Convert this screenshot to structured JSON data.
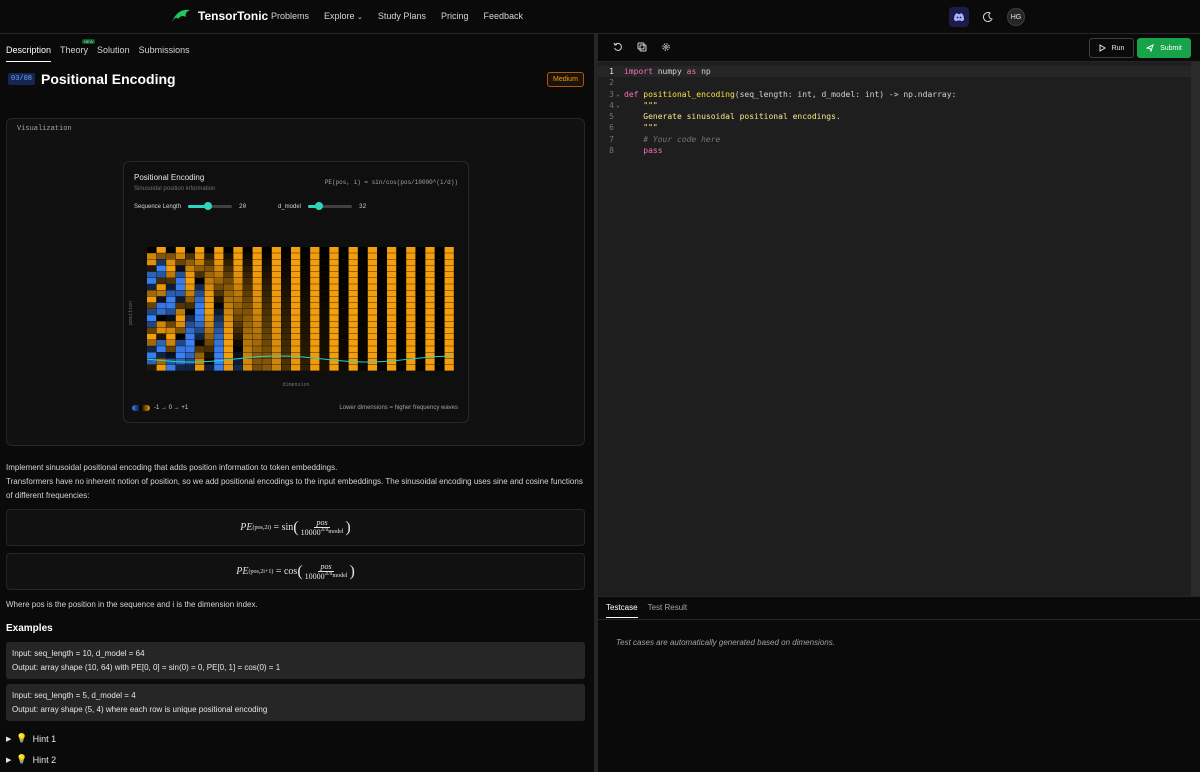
{
  "app": {
    "name": "TensorTonic"
  },
  "nav": {
    "items": [
      "Problems",
      "Explore",
      "Study Plans",
      "Pricing",
      "Feedback"
    ]
  },
  "user": {
    "initials": "HG"
  },
  "tabs": {
    "description": "Description",
    "theory": "Theory",
    "theory_badge": "NEW",
    "solution": "Solution",
    "submissions": "Submissions"
  },
  "problem": {
    "id": "03/08",
    "title": "Positional Encoding",
    "difficulty": "Medium"
  },
  "viz": {
    "label": "Visualization",
    "card_title": "Positional Encoding",
    "card_subtitle": "Sinusoidal position information",
    "formula": "PE(pos, i) = sin/cos(pos/10000^(i/d))",
    "seq_label": "Sequence Length",
    "seq_value": "20",
    "seq_fraction": 0.45,
    "dmodel_label": "d_model",
    "dmodel_value": "32",
    "dmodel_fraction": 0.25,
    "ylabel": "position",
    "xlabel": "dimension",
    "legend": "-1 → 0 → +1",
    "note": "Lower dimensions = higher frequency waves",
    "colors": {
      "negative": "#3b82f6",
      "zero": "#000000",
      "positive": "#f59e0b",
      "wave": "#2dd4bf"
    }
  },
  "description": {
    "p1": "Implement sinusoidal positional encoding that adds position information to token embeddings.",
    "p2": "Transformers have no inherent notion of position, so we add positional encodings to the input embeddings. The sinusoidal encoding uses sine and cosine functions of different frequencies:",
    "f1_lhs": "PE",
    "f1_sub": "(pos,2i)",
    "f1_fn": "= sin",
    "f1_num": "pos",
    "f1_den": "10000",
    "f1_exp": "2i/d",
    "f2_lhs": "PE",
    "f2_sub": "(pos,2i+1)",
    "f2_fn": "= cos",
    "f2_num": "pos",
    "f2_den": "10000",
    "f2_exp": "2i/d",
    "f_model": "model",
    "where": "Where pos is the position in the sequence and i is the dimension index."
  },
  "examples": {
    "heading": "Examples",
    "items": [
      {
        "input": "Input: seq_length = 10, d_model = 64",
        "output": "Output: array shape (10, 64) with PE[0, 0] = sin(0) = 0, PE[0, 1] = cos(0) = 1"
      },
      {
        "input": "Input: seq_length = 5, d_model = 4",
        "output": "Output: array shape (5, 4) where each row is unique positional encoding"
      }
    ]
  },
  "hints": [
    "Hint 1",
    "Hint 2"
  ],
  "editor": {
    "run": "Run",
    "submit": "Submit",
    "lines": [
      {
        "n": "1"
      },
      {
        "n": "2"
      },
      {
        "n": "3"
      },
      {
        "n": "4"
      },
      {
        "n": "5"
      },
      {
        "n": "6"
      },
      {
        "n": "7"
      },
      {
        "n": "8"
      }
    ],
    "code": {
      "l1a": "import",
      "l1b": " numpy ",
      "l1c": "as",
      "l1d": " np",
      "l3a": "def ",
      "l3b": "positional_encoding",
      "l3c": "(seq_length: int, d_model: int) -> np.ndarray:",
      "l4": "    \"\"\"",
      "l5": "    Generate sinusoidal positional encodings.",
      "l6": "    \"\"\"",
      "l7": "    # Your code here",
      "l8": "    pass"
    }
  },
  "bottom": {
    "tab_testcase": "Testcase",
    "tab_result": "Test Result",
    "note": "Test cases are automatically generated based on dimensions."
  }
}
